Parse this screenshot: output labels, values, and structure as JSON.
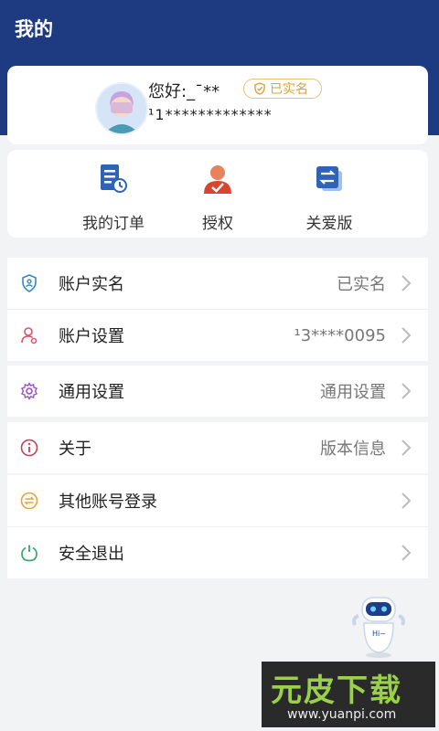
{
  "header": {
    "title": "我的"
  },
  "profile": {
    "greeting": "您好:_ˉ**",
    "verified_badge": "已实名",
    "phone": "¹1*************"
  },
  "quick_actions": [
    {
      "label": "我的订单",
      "icon": "order-document-icon"
    },
    {
      "label": "授权",
      "icon": "authorize-person-icon"
    },
    {
      "label": "关爱版",
      "icon": "care-mode-switch-icon"
    }
  ],
  "menu_groups": [
    [
      {
        "label": "账户实名",
        "value": "已实名",
        "icon": "shield-id-icon"
      },
      {
        "label": "账户设置",
        "value": "¹3****0095",
        "icon": "user-settings-icon"
      }
    ],
    [
      {
        "label": "通用设置",
        "value": "通用设置",
        "icon": "gear-icon"
      }
    ],
    [
      {
        "label": "关于",
        "value": "版本信息",
        "icon": "info-icon"
      }
    ],
    [
      {
        "label": "其他账号登录",
        "value": "",
        "icon": "switch-account-icon"
      },
      {
        "label": "安全退出",
        "value": "",
        "icon": "power-icon"
      }
    ]
  ],
  "watermark": {
    "main": "元皮下载",
    "sub": "www.yuanpi.com"
  },
  "colors": {
    "header": "#1e3a80",
    "badge": "#e7c27a",
    "background": "#f2f3f5"
  }
}
